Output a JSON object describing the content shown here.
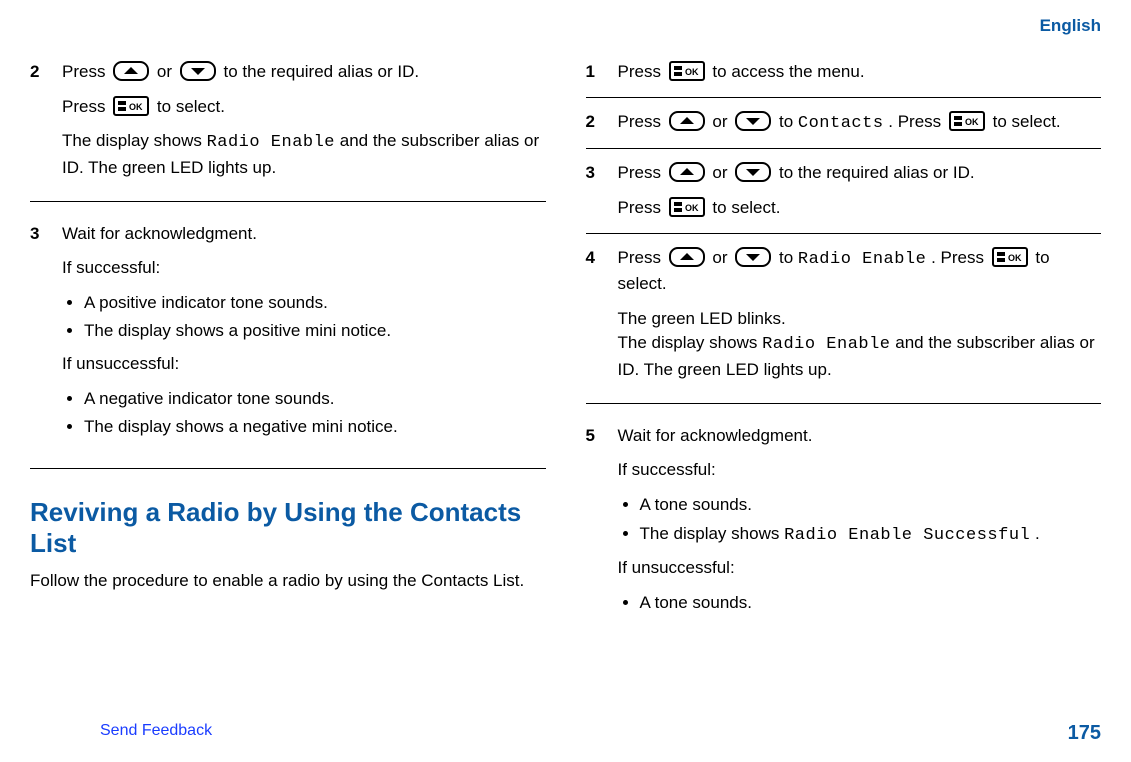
{
  "header": {
    "language": "English"
  },
  "left": {
    "step2": {
      "num": "2",
      "p1a": "Press ",
      "p1b": " or ",
      "p1c": " to the required alias or ID.",
      "p2a": "Press ",
      "p2b": " to select.",
      "p3a": "The display shows ",
      "p3code": "Radio Enable",
      "p3b": " and the subscriber alias or ID. The green LED lights up."
    },
    "step3": {
      "num": "3",
      "line1": "Wait for acknowledgment.",
      "ifsuccess": "If successful:",
      "succ": [
        "A positive indicator tone sounds.",
        "The display shows a positive mini notice."
      ],
      "ifunsuccess": "If unsuccessful:",
      "unsucc": [
        "A negative indicator tone sounds.",
        "The display shows a negative mini notice."
      ]
    },
    "sectionTitle": "Reviving a Radio by Using the Contacts List",
    "intro": "Follow the procedure to enable a radio by using the Contacts List."
  },
  "right": {
    "step1": {
      "num": "1",
      "p1a": "Press ",
      "p1b": " to access the menu."
    },
    "step2": {
      "num": "2",
      "p1a": "Press ",
      "p1b": " or ",
      "p1c": " to ",
      "p1code": "Contacts",
      "p1d": ". Press ",
      "p1e": " to select."
    },
    "step3": {
      "num": "3",
      "p1a": "Press ",
      "p1b": " or ",
      "p1c": " to the required alias or ID.",
      "p2a": "Press ",
      "p2b": " to select."
    },
    "step4": {
      "num": "4",
      "p1a": "Press ",
      "p1b": " or ",
      "p1c": " to ",
      "p1code": "Radio Enable",
      "p1d": ". Press ",
      "p1e": " to select.",
      "p2": "The green LED blinks.",
      "p3a": "The display shows ",
      "p3code": "Radio Enable",
      "p3b": " and the subscriber alias or ID. The green LED lights up."
    },
    "step5": {
      "num": "5",
      "line1": "Wait for acknowledgment.",
      "ifsuccess": "If successful:",
      "succ1": "A tone sounds.",
      "succ2a": "The display shows ",
      "succ2code": "Radio Enable Successful",
      "succ2b": ".",
      "ifunsuccess": "If unsuccessful:",
      "unsucc1": "A tone sounds."
    }
  },
  "footer": {
    "sendFeedback": "Send Feedback",
    "pageNum": "175"
  }
}
